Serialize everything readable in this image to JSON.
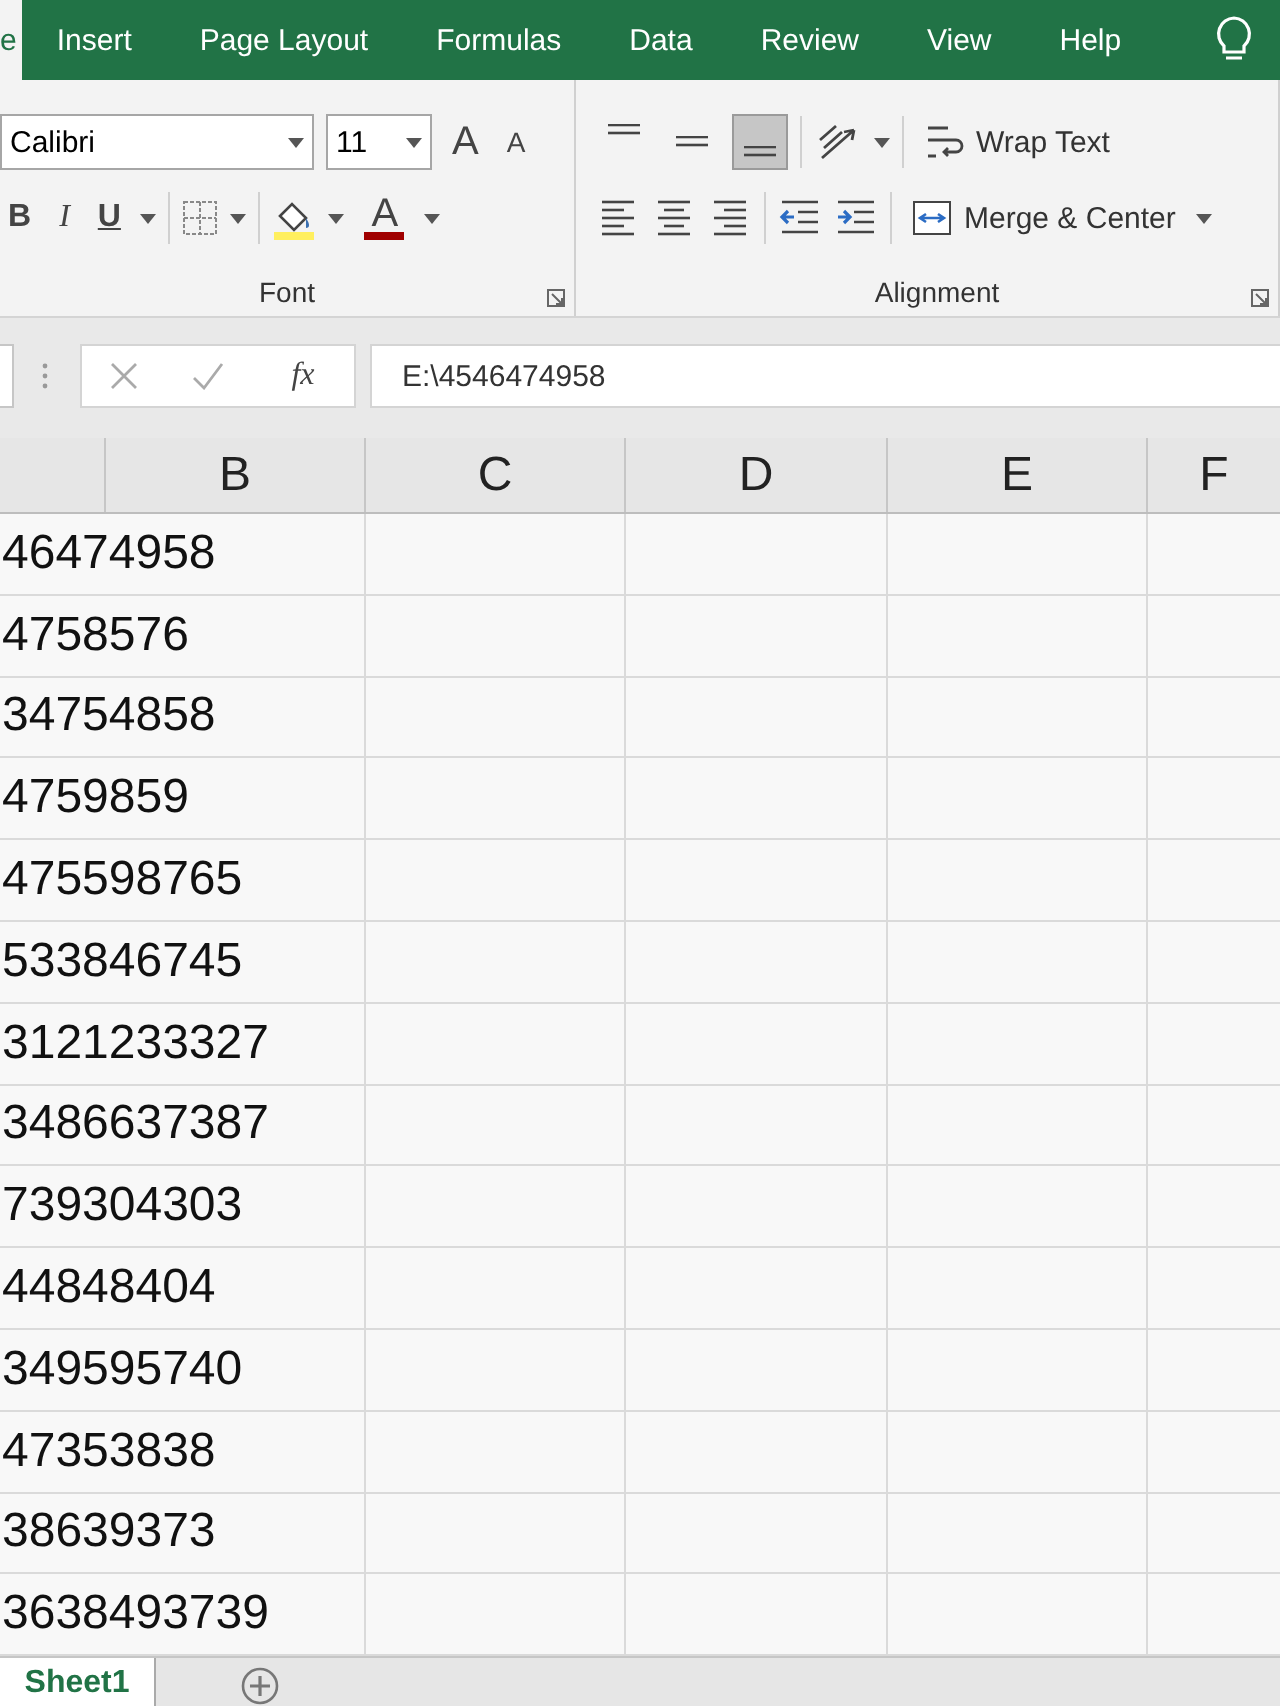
{
  "ribbon_tabs": [
    {
      "label": "e",
      "selected": true
    },
    {
      "label": "Insert",
      "selected": false
    },
    {
      "label": "Page Layout",
      "selected": false
    },
    {
      "label": "Formulas",
      "selected": false
    },
    {
      "label": "Data",
      "selected": false
    },
    {
      "label": "Review",
      "selected": false
    },
    {
      "label": "View",
      "selected": false
    },
    {
      "label": "Help",
      "selected": false
    }
  ],
  "font_group": {
    "font_name": "Calibri",
    "font_size": "11",
    "grow_glyph": "A",
    "shrink_glyph": "A",
    "bold": "B",
    "italic": "I",
    "underline": "U",
    "font_color_glyph": "A",
    "label": "Font"
  },
  "alignment_group": {
    "vertical_align": [
      {
        "selected": false
      },
      {
        "selected": false
      },
      {
        "selected": true
      }
    ],
    "wrap_text": "Wrap Text",
    "merge_center": "Merge & Center",
    "label": "Alignment"
  },
  "formula_bar": {
    "fx_label": "fx",
    "value": "E:\\4546474958"
  },
  "columns": [
    "B",
    "C",
    "D",
    "E",
    "F"
  ],
  "rows": [
    "46474958",
    "4758576",
    "34754858",
    "4759859",
    "475598765",
    "533846745",
    "3121233327",
    "3486637387",
    "739304303",
    "44848404",
    "349595740",
    "47353838",
    "38639373",
    "3638493739"
  ],
  "sheets": [
    {
      "label": "Sheet1",
      "selected": true
    }
  ]
}
